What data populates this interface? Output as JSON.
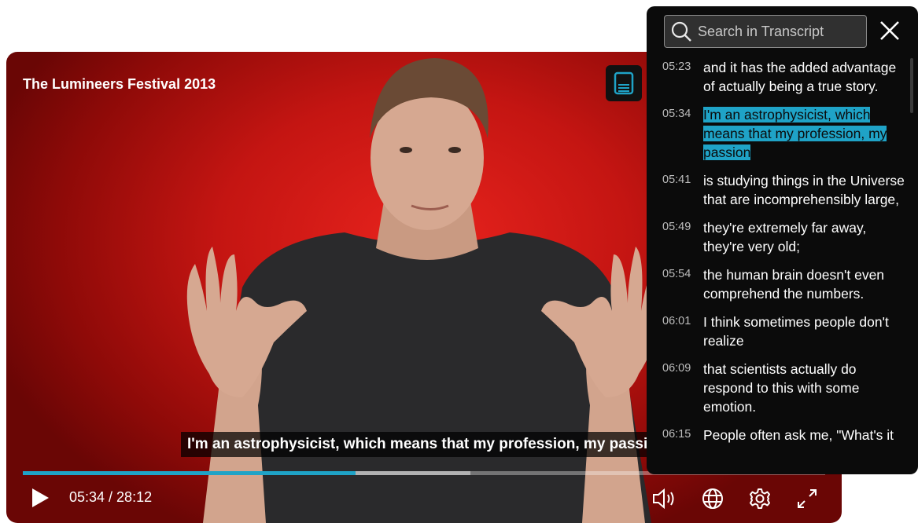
{
  "video": {
    "title": "The Lumineers Festival 2013",
    "caption": "I'm an astrophysicist, which means that my profession, my passion",
    "time_display": "05:34 / 28:12",
    "progress_fraction": 0.415,
    "buffered_fraction": 0.558
  },
  "transcript": {
    "search_placeholder": "Search in Transcript",
    "entries": [
      {
        "time": "05:23",
        "text": "and it has the added advantage of actually being a true story.",
        "active": false
      },
      {
        "time": "05:34",
        "text": "I'm an astrophysicist, which means that my profession, my passion",
        "active": true
      },
      {
        "time": "05:41",
        "text": "is studying things in the Universe that are incomprehensibly large,",
        "active": false
      },
      {
        "time": "05:49",
        "text": "they're extremely far away, they're very old;",
        "active": false
      },
      {
        "time": "05:54",
        "text": "the human brain doesn't even comprehend the numbers.",
        "active": false
      },
      {
        "time": "06:01",
        "text": "I think sometimes people don't realize",
        "active": false
      },
      {
        "time": "06:09",
        "text": "that scientists actually do respond to this with some emotion.",
        "active": false
      },
      {
        "time": "06:15",
        "text": "People often ask me, \"What's it",
        "active": false
      }
    ]
  },
  "icons": {
    "play": "play-icon",
    "volume": "volume-icon",
    "language": "globe-icon",
    "settings": "gear-icon",
    "fullscreen": "expand-icon",
    "transcript": "transcript-icon",
    "search": "search-icon",
    "close": "close-icon"
  },
  "colors": {
    "accent": "#1fa3c7",
    "video_background": "#d11a16",
    "panel_background": "#0b0b0b"
  }
}
